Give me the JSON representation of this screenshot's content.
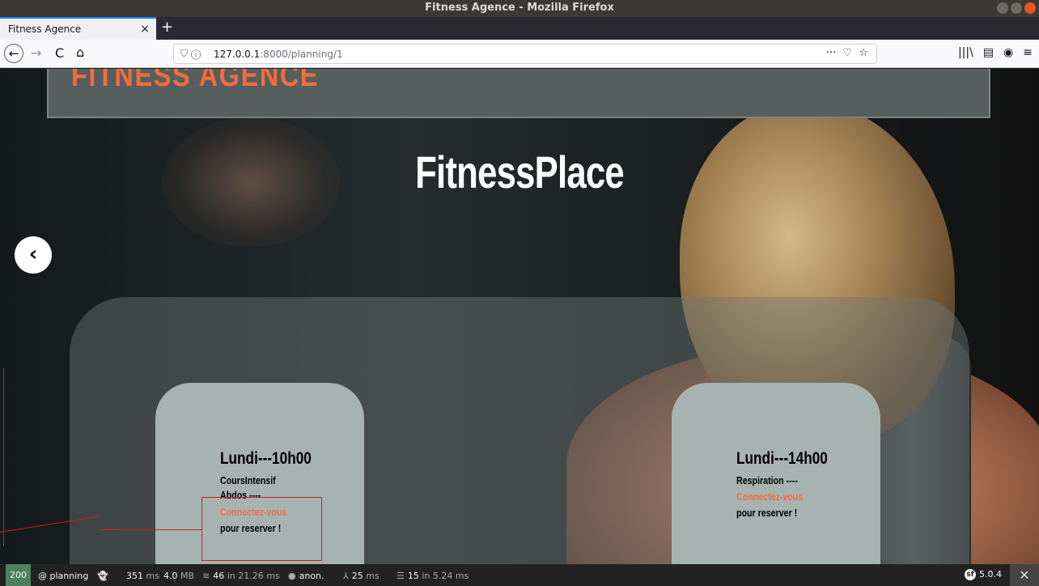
{
  "window": {
    "title": "Fitness Agence - Mozilla Firefox"
  },
  "browser": {
    "tab_title": "Fitness Agence",
    "tab_close": "×",
    "new_tab": "+",
    "back": "←",
    "forward": "→",
    "reload": "C",
    "home": "⌂",
    "url_host": "127.0.0.1",
    "url_rest": ":8000/planning/1",
    "url_more": "···",
    "url_pocket": "♡",
    "url_bookmark": "☆",
    "tool_library": "|||\\",
    "tool_sidebar": "▤",
    "tool_account": "◉",
    "tool_menu": "≡"
  },
  "page": {
    "logo": "FITNESS AGENCE",
    "hero_title": "FitnessPlace",
    "prev_arrow": "‹",
    "cards": [
      {
        "day": "Lundi---10h00",
        "lines": [
          "CoursIntensif",
          "Abdos ----"
        ],
        "link": "Connectez-vous",
        "after": "pour reserver !"
      },
      {
        "day": "Lundi---14h00",
        "lines": [
          "Respiration ----"
        ],
        "link": "Connectez-vous",
        "after": "pour reserver !"
      }
    ]
  },
  "toolbar": {
    "status": "200",
    "route": "@ planning",
    "time": "351",
    "time_unit": "ms",
    "memory": "4.0",
    "memory_unit": "MB",
    "cache_count": "46",
    "cache_time": "in 21.26 ms",
    "user": "anon.",
    "twig": "25",
    "twig_unit": "ms",
    "db_count": "15",
    "db_time": "in 5.24 ms",
    "version": "5.0.4",
    "close": "✕"
  }
}
